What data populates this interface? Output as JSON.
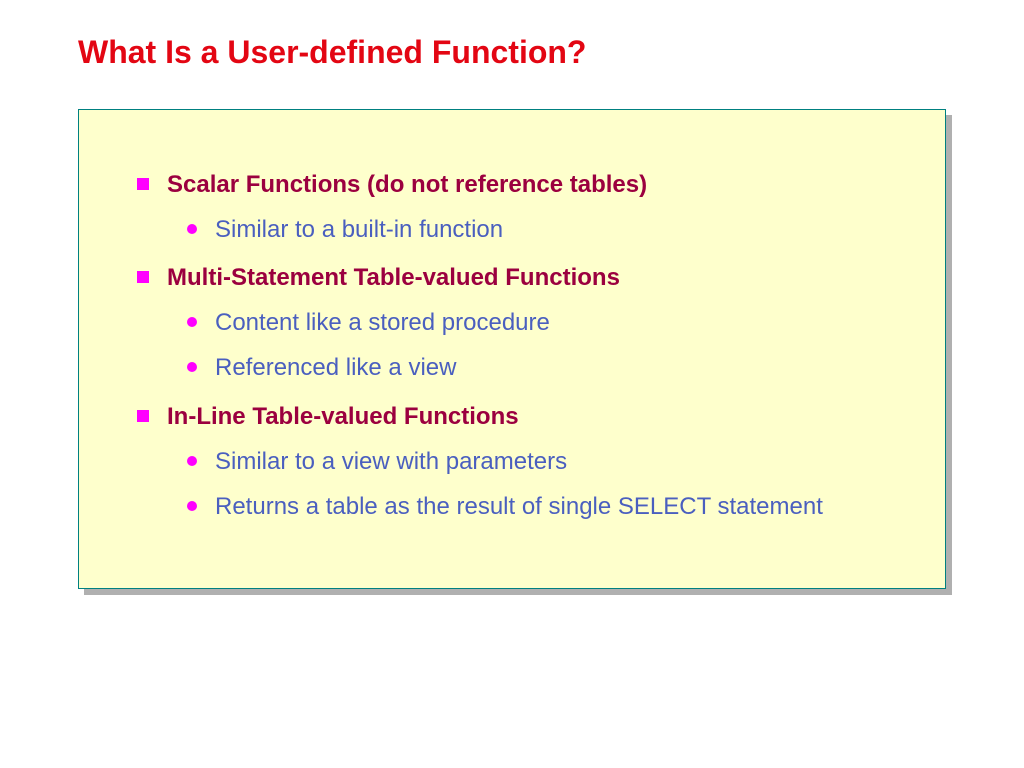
{
  "title": "What Is a User-defined Function?",
  "sections": [
    {
      "heading": "Scalar Functions (do not reference tables)",
      "items": [
        "Similar to a built-in function"
      ]
    },
    {
      "heading": "Multi-Statement Table-valued Functions",
      "items": [
        "Content like a stored procedure",
        "Referenced like a view"
      ]
    },
    {
      "heading": "In-Line Table-valued Functions",
      "items": [
        "Similar to a view with parameters",
        "Returns a table as the result of single SELECT statement"
      ]
    }
  ]
}
